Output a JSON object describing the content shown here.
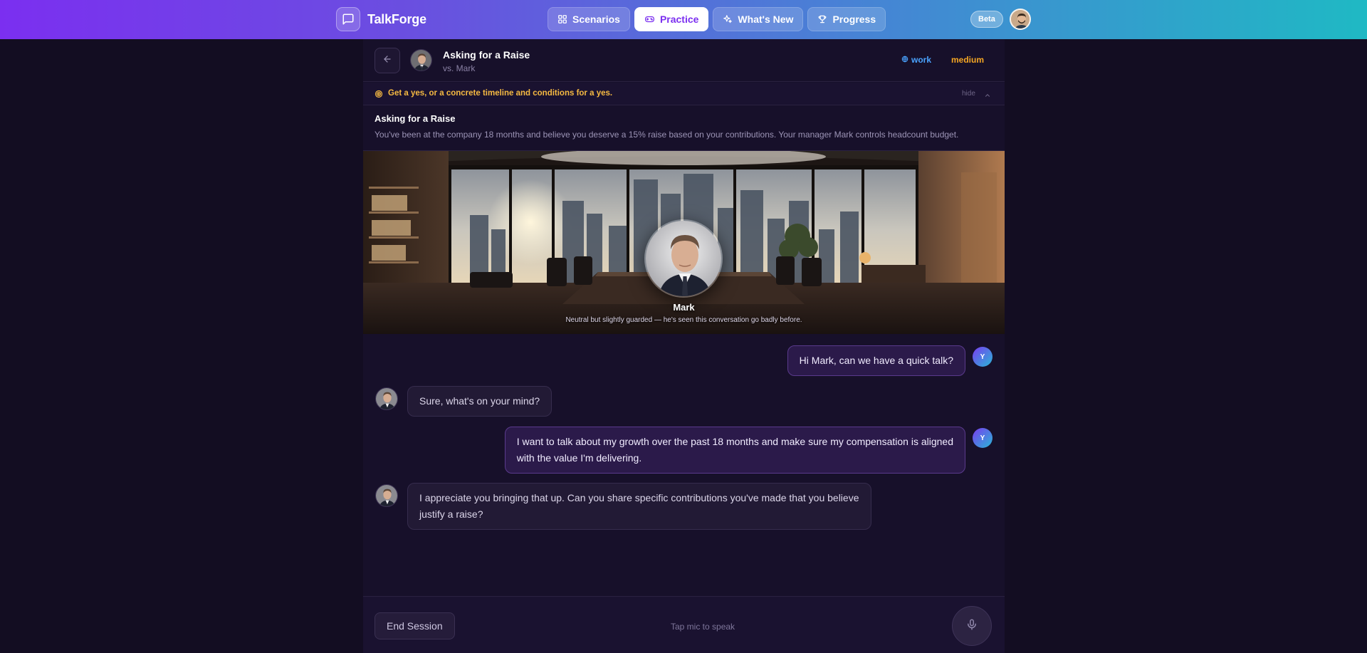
{
  "app": {
    "name": "TalkForge",
    "badge": "Beta"
  },
  "nav": [
    {
      "label": "Scenarios",
      "icon": "grid-icon",
      "active": false
    },
    {
      "label": "Practice",
      "icon": "gamepad-icon",
      "active": true
    },
    {
      "label": "What's New",
      "icon": "sparkles-icon",
      "active": false
    },
    {
      "label": "Progress",
      "icon": "trophy-icon",
      "active": false
    }
  ],
  "session": {
    "title": "Asking for a Raise",
    "opponent": "vs. Mark",
    "category": "work",
    "difficulty": "medium"
  },
  "goal": {
    "text": "Get a yes, or a concrete timeline and conditions for a yes.",
    "hide_label": "hide"
  },
  "scenario": {
    "title": "Asking for a Raise",
    "description": "You've been at the company 18 months and believe you deserve a 15% raise based on your contributions. Your manager Mark controls headcount budget."
  },
  "character": {
    "name": "Mark",
    "mood": "Neutral but slightly guarded — he's seen this conversation go badly before."
  },
  "messages": [
    {
      "role": "user",
      "badge": "Y",
      "lines": [
        "Hi Mark, can we have a quick talk?"
      ]
    },
    {
      "role": "bot",
      "lines": [
        "Sure, what's on your mind?"
      ]
    },
    {
      "role": "user",
      "badge": "Y",
      "lines": [
        "I want to talk about my growth over the past 18 months and make sure my compensation is aligned",
        "with the value I'm delivering."
      ]
    },
    {
      "role": "bot",
      "lines": [
        "I appreciate you bringing that up. Can you share specific contributions you've made that you believe",
        "justify a raise?"
      ]
    }
  ],
  "footer": {
    "end_label": "End Session",
    "hint": "Tap mic to speak"
  },
  "colors": {
    "brand_gradient_start": "#7b2ff0",
    "brand_gradient_end": "#1fb9c4",
    "tag_work": "#4aa3ff",
    "tag_medium": "#f5a623",
    "goal": "#f5b942",
    "background": "#130d22"
  }
}
